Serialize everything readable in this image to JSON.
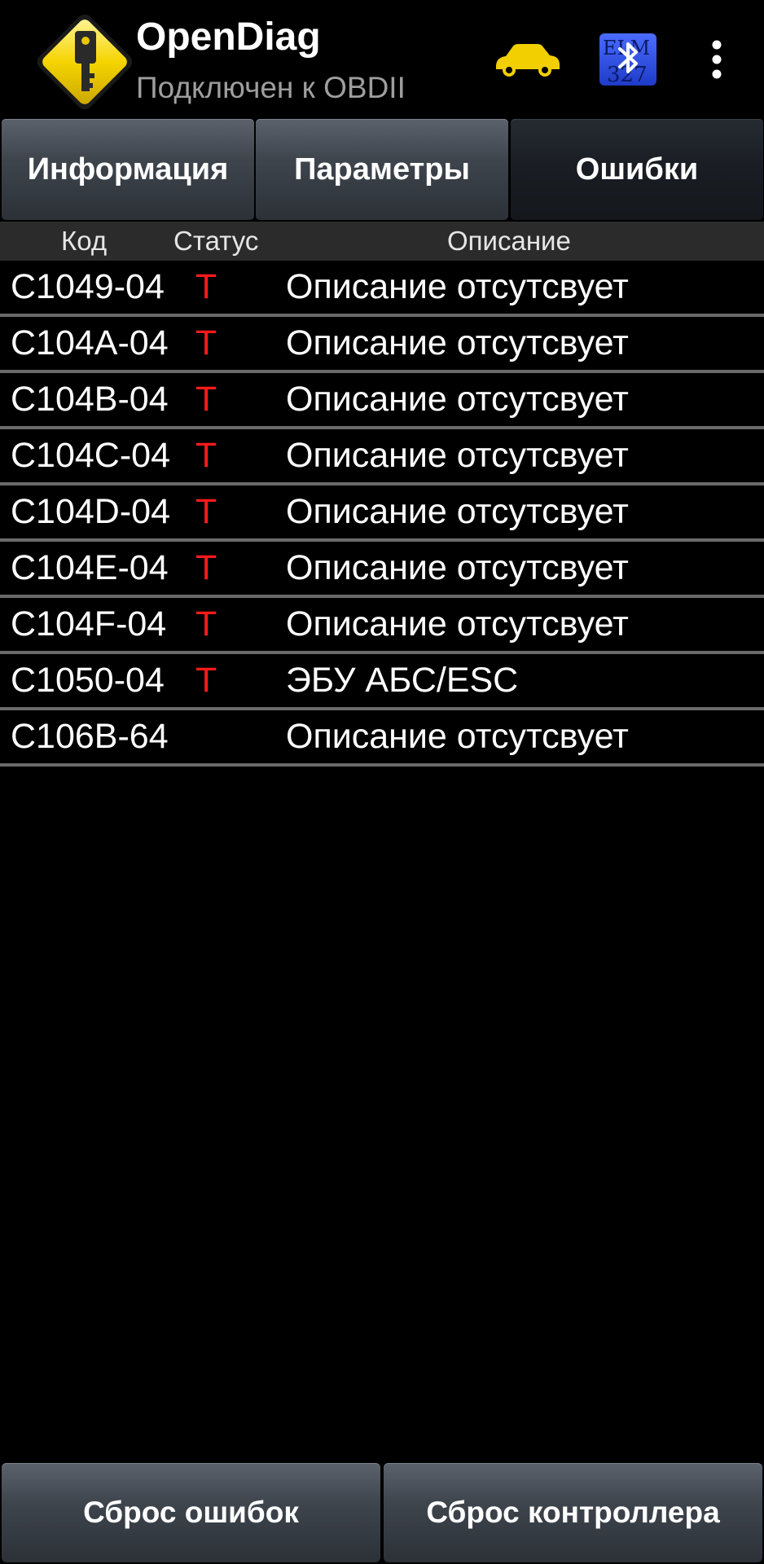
{
  "appbar": {
    "title": "OpenDiag",
    "subtitle": "Подключен к OBDII",
    "icons": [
      "key-warning-logo-icon",
      "car-icon",
      "bluetooth-elm327-icon",
      "overflow-menu-icon"
    ],
    "car_color": "#f2cf00",
    "bt_badge_text": "ELM 327"
  },
  "tabs": [
    {
      "label": "Информация",
      "active": false
    },
    {
      "label": "Параметры",
      "active": false
    },
    {
      "label": "Ошибки",
      "active": true
    }
  ],
  "table": {
    "headers": {
      "code": "Код",
      "status": "Статус",
      "description": "Описание"
    },
    "rows": [
      {
        "code": "C1049-04",
        "status": "T",
        "description": "Описание отсутсвует"
      },
      {
        "code": "C104A-04",
        "status": "T",
        "description": "Описание отсутсвует"
      },
      {
        "code": "C104B-04",
        "status": "T",
        "description": "Описание отсутсвует"
      },
      {
        "code": "C104C-04",
        "status": "T",
        "description": "Описание отсутсвует"
      },
      {
        "code": "C104D-04",
        "status": "T",
        "description": "Описание отсутсвует"
      },
      {
        "code": "C104E-04",
        "status": "T",
        "description": "Описание отсутсвует"
      },
      {
        "code": "C104F-04",
        "status": "T",
        "description": "Описание отсутсвует"
      },
      {
        "code": "C1050-04",
        "status": "T",
        "description": "ЭБУ АБС/ESC"
      },
      {
        "code": "C106B-64",
        "status": "",
        "description": "Описание отсутсвует"
      }
    ],
    "status_color": "#ff1a1a"
  },
  "buttons": {
    "reset_errors": "Сброс ошибок",
    "reset_controller": "Сброс контроллера"
  }
}
